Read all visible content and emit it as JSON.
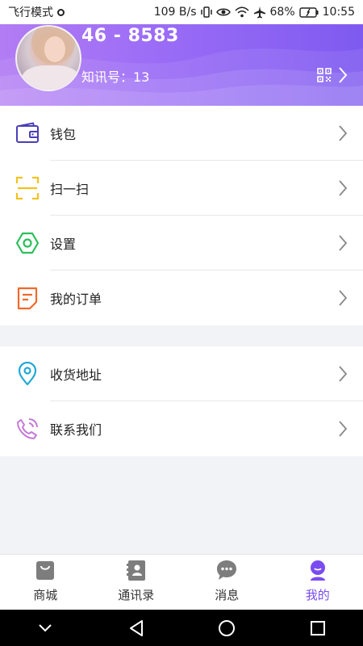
{
  "status_bar": {
    "left_text": "飞行模式",
    "speed": "109 B/s",
    "battery": "68%",
    "time": "10:55"
  },
  "profile": {
    "name": "46 - 8583",
    "id_text": "知讯号：13"
  },
  "menu_group_1": [
    {
      "label": "钱包",
      "icon": "wallet-icon",
      "color": "#4a3fb8"
    },
    {
      "label": "扫一扫",
      "icon": "scan-icon",
      "color": "#f3c21d"
    },
    {
      "label": "设置",
      "icon": "settings-hexagon-icon",
      "color": "#2bbf5b"
    },
    {
      "label": "我的订单",
      "icon": "order-icon",
      "color": "#f06a2b"
    }
  ],
  "menu_group_2": [
    {
      "label": "收货地址",
      "icon": "location-pin-icon",
      "color": "#22a8d6"
    },
    {
      "label": "联系我们",
      "icon": "phone-icon",
      "color": "#c57ad6"
    }
  ],
  "tabs": [
    {
      "label": "商城",
      "icon": "shop-bag-icon",
      "active": false
    },
    {
      "label": "通讯录",
      "icon": "contacts-icon",
      "active": false
    },
    {
      "label": "消息",
      "icon": "message-icon",
      "active": false
    },
    {
      "label": "我的",
      "icon": "me-icon",
      "active": true
    }
  ],
  "colors": {
    "header_gradient_start": "#b27cf4",
    "header_gradient_end": "#7f5af0",
    "accent": "#7a4cf0",
    "background": "#f2f3f7"
  }
}
